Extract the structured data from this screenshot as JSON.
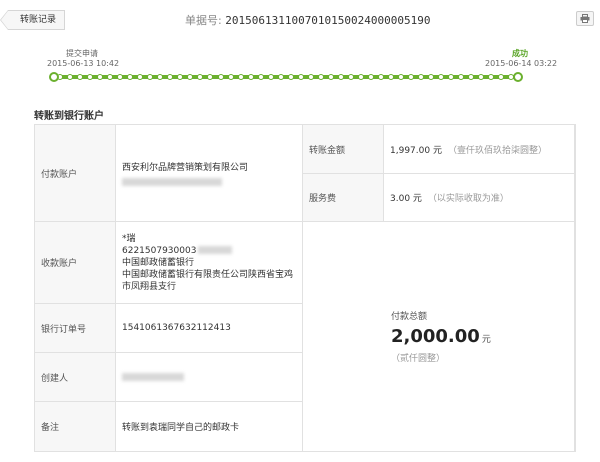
{
  "header": {
    "back_label": "转账记录",
    "doc_no_label": "单据号:",
    "doc_no_value": "2015061311007010150024000005190"
  },
  "progress": {
    "start_label": "提交申请",
    "start_time": "2015-06-13 10:42",
    "end_label": "成功",
    "end_time": "2015-06-14 03:22",
    "accent_color": "#6bb02e"
  },
  "section": {
    "title": "转账到银行账户"
  },
  "details": {
    "payer_label": "付款账户",
    "payer_name": "西安利尔品牌营销策划有限公司",
    "amount_label": "转账金额",
    "amount_value": "1,997.00 元",
    "amount_cn": "（壹仟玖佰玖拾柒圆整）",
    "fee_label": "服务费",
    "fee_value": "3.00 元",
    "fee_note": "（以实际收取为准）",
    "payee_label": "收款账户",
    "payee_name": "*瑞",
    "payee_account": "6221507930003",
    "payee_bank": "中国邮政储蓄银行",
    "payee_branch": "中国邮政储蓄银行有限责任公司陕西省宝鸡市凤翔县支行",
    "order_label": "银行订单号",
    "order_value": "1541061367632112413",
    "creator_label": "创建人",
    "remark_label": "备注",
    "remark_value": "转账到袁瑞同学自己的邮政卡",
    "total_label": "付款总额",
    "total_value": "2,000.00",
    "total_unit": "元",
    "total_cn": "（贰仟圆整）"
  }
}
